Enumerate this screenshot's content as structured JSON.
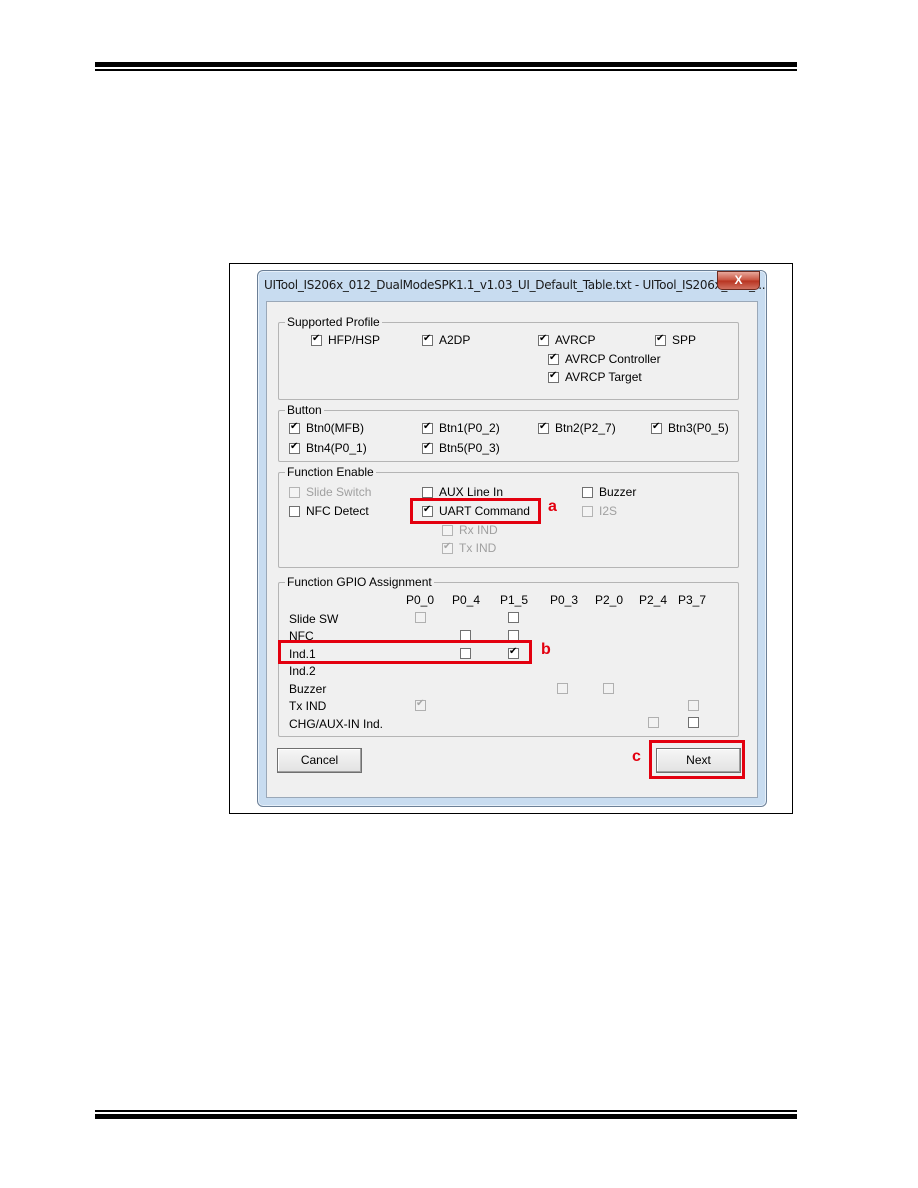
{
  "window": {
    "title": "UITool_IS206x_012_DualModeSPK1.1_v1.03_UI_Default_Table.txt - UITool_IS206x_012_...",
    "close_glyph": "X"
  },
  "supported_profile": {
    "label": "Supported Profile",
    "items": [
      {
        "label": "HFP/HSP",
        "checked": true
      },
      {
        "label": "A2DP",
        "checked": true
      },
      {
        "label": "AVRCP",
        "checked": true
      },
      {
        "label": "SPP",
        "checked": true
      },
      {
        "label": "AVRCP Controller",
        "checked": true
      },
      {
        "label": "AVRCP Target",
        "checked": true
      }
    ]
  },
  "button_group": {
    "label": "Button",
    "items": [
      {
        "label": "Btn0(MFB)",
        "checked": true
      },
      {
        "label": "Btn1(P0_2)",
        "checked": true
      },
      {
        "label": "Btn2(P2_7)",
        "checked": true
      },
      {
        "label": "Btn3(P0_5)",
        "checked": true
      },
      {
        "label": "Btn4(P0_1)",
        "checked": true
      },
      {
        "label": "Btn5(P0_3)",
        "checked": true
      }
    ]
  },
  "function_enable": {
    "label": "Function Enable",
    "items": [
      {
        "label": "Slide Switch",
        "checked": false,
        "disabled": true
      },
      {
        "label": "AUX Line In",
        "checked": false,
        "disabled": false
      },
      {
        "label": "Buzzer",
        "checked": false,
        "disabled": false
      },
      {
        "label": "NFC Detect",
        "checked": false,
        "disabled": false
      },
      {
        "label": "UART Command",
        "checked": true,
        "disabled": false
      },
      {
        "label": "I2S",
        "checked": false,
        "disabled": true
      },
      {
        "label": "Rx IND",
        "checked": false,
        "disabled": true
      },
      {
        "label": "Tx IND",
        "checked": true,
        "disabled": true
      }
    ]
  },
  "gpio_assignment": {
    "label": "Function GPIO Assignment",
    "columns": [
      "P0_0",
      "P0_4",
      "P1_5",
      "P0_3",
      "P2_0",
      "P2_4",
      "P3_7"
    ],
    "rows": [
      {
        "label": "Slide SW",
        "cells": {
          "P0_0": {
            "checked": false,
            "disabled": true
          },
          "P1_5": {
            "checked": false,
            "disabled": false
          }
        }
      },
      {
        "label": "NFC",
        "cells": {
          "P0_4": {
            "checked": false,
            "disabled": false
          },
          "P1_5": {
            "checked": false,
            "disabled": false
          }
        }
      },
      {
        "label": "Ind.1",
        "cells": {
          "P0_4": {
            "checked": false,
            "disabled": false
          },
          "P1_5": {
            "checked": true,
            "disabled": false
          }
        }
      },
      {
        "label": "Ind.2",
        "cells": {}
      },
      {
        "label": "Buzzer",
        "cells": {
          "P0_3": {
            "checked": false,
            "disabled": true
          },
          "P2_0": {
            "checked": false,
            "disabled": true
          }
        }
      },
      {
        "label": "Tx IND",
        "cells": {
          "P0_0": {
            "checked": true,
            "disabled": true
          },
          "P3_7": {
            "checked": false,
            "disabled": true
          }
        }
      },
      {
        "label": "CHG/AUX-IN Ind.",
        "cells": {
          "P2_4": {
            "checked": false,
            "disabled": true
          },
          "P3_7": {
            "checked": false,
            "disabled": false
          }
        }
      }
    ]
  },
  "buttons": {
    "cancel": "Cancel",
    "next": "Next"
  },
  "annotations": {
    "a": "a",
    "b": "b",
    "c": "c",
    "color": "#e3000f"
  }
}
